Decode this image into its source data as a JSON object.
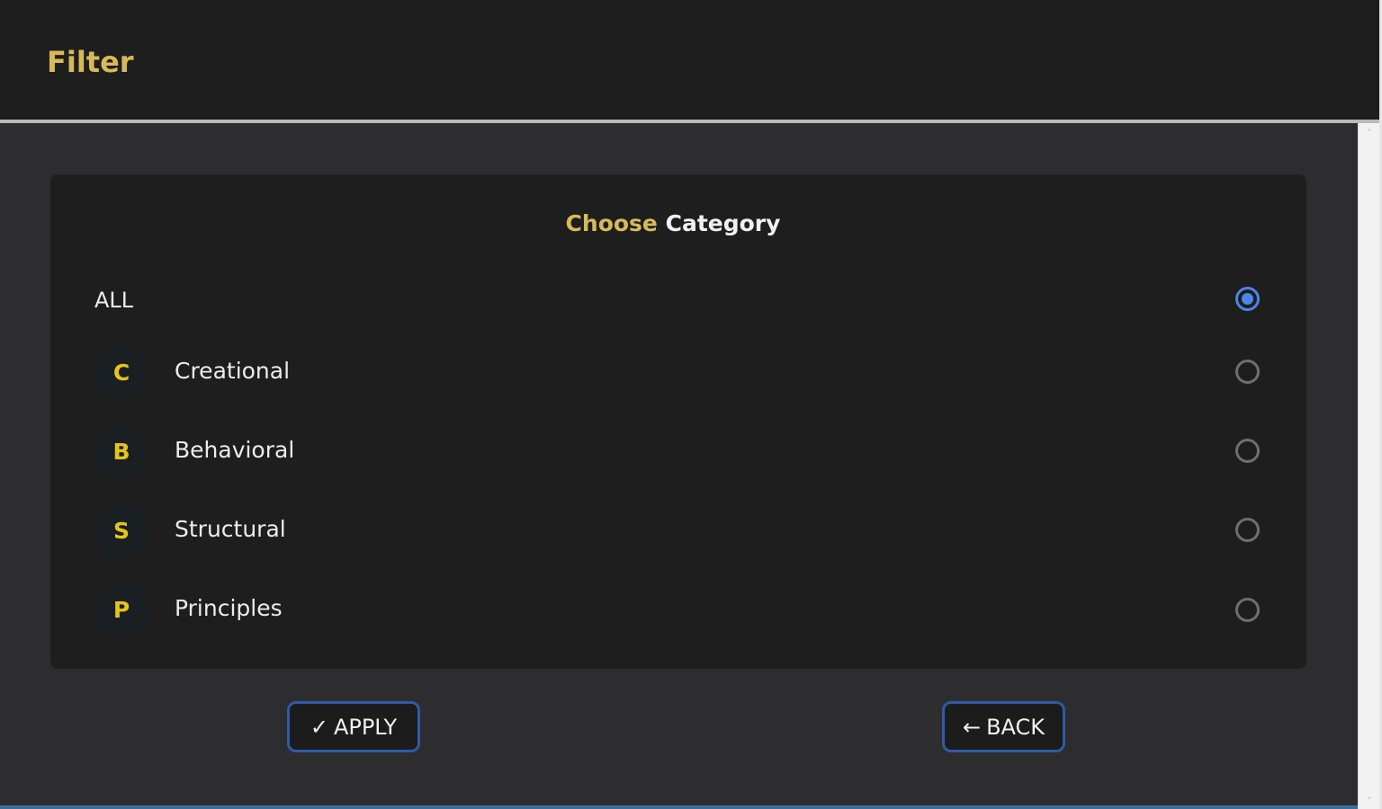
{
  "header": {
    "title": "Filter"
  },
  "card": {
    "title_part1": "Choose",
    "title_part2": "Category",
    "all_label": "ALL",
    "options": [
      {
        "letter": "C",
        "label": "Creational",
        "selected": false
      },
      {
        "letter": "B",
        "label": "Behavioral",
        "selected": false
      },
      {
        "letter": "S",
        "label": "Structural",
        "selected": false
      },
      {
        "letter": "P",
        "label": "Principles",
        "selected": false
      }
    ],
    "all_selected": true
  },
  "buttons": {
    "apply_label": "APPLY",
    "apply_icon": "check-icon",
    "back_label": "BACK",
    "back_icon": "arrow-left-icon"
  },
  "colors": {
    "accent_gold": "#d8b95a",
    "letter_yellow": "#e5c518",
    "radio_blue": "#4a86e8",
    "button_border": "#2f5aa8"
  }
}
